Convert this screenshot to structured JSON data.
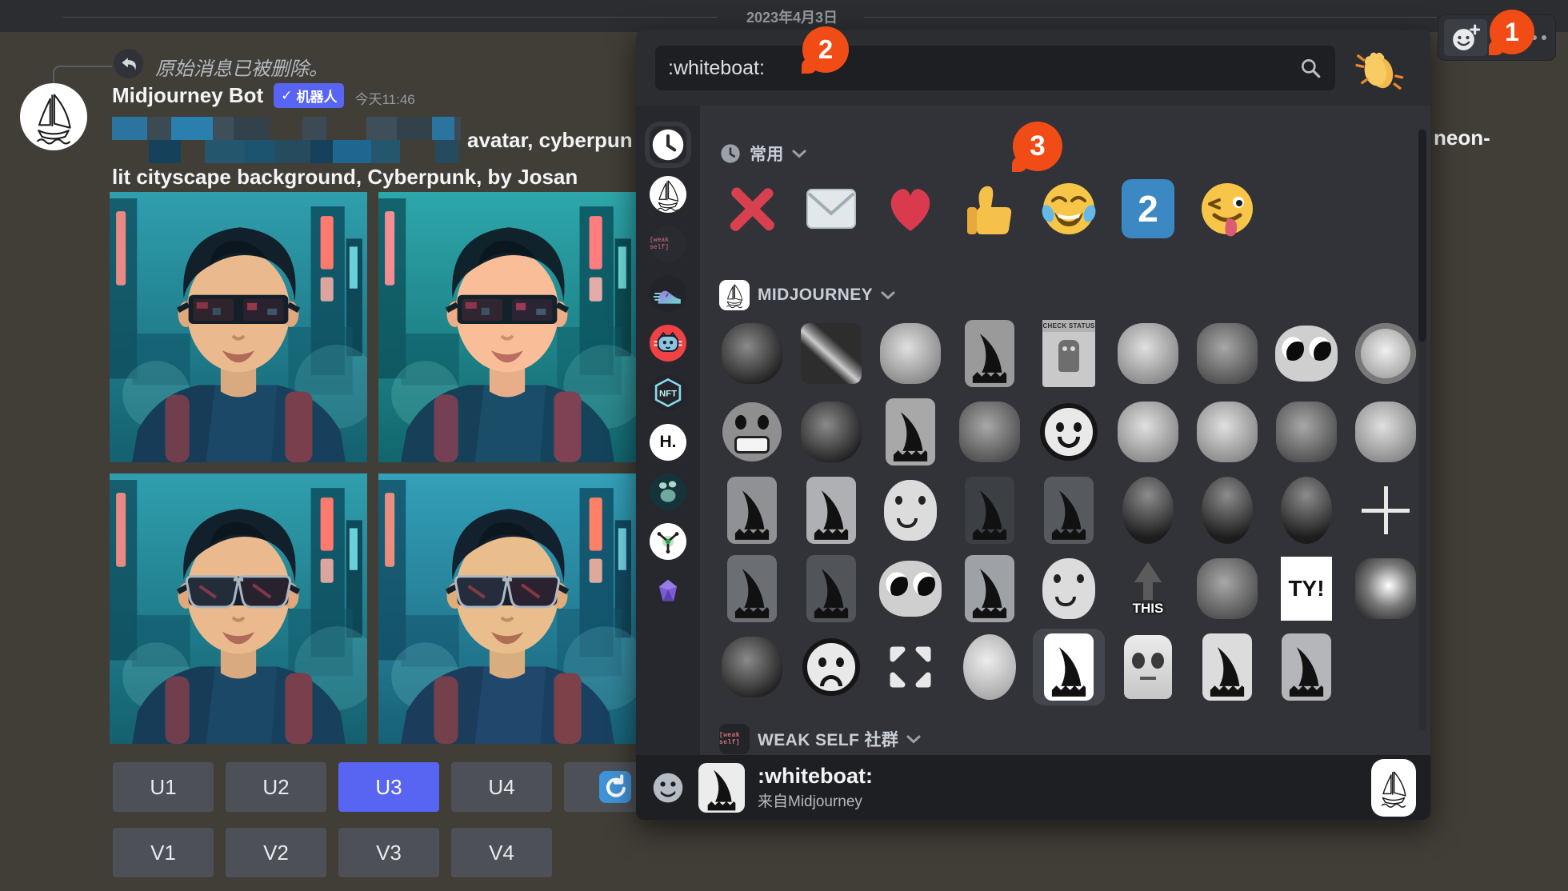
{
  "date_divider": "2023年4月3日",
  "reply": {
    "deleted_text": "原始消息已被删除。"
  },
  "message": {
    "author": "Midjourney Bot",
    "bot_check": "✓",
    "bot_badge": "机器人",
    "timestamp": "今天11:46",
    "line1_left": "avatar, cyberpun",
    "line1_right": "neon-",
    "line2": "lit cityscape background, Cyberpunk, by Josan"
  },
  "censor": {
    "palette": [
      "#2c74a0",
      "#1c546f",
      "#3c4a53",
      "#274b5e",
      "#2a7fae",
      "#15415a",
      "#3f4f59",
      "#1f6690",
      "#33414a",
      "#24566e"
    ],
    "widths": [
      44,
      30,
      52,
      26,
      46,
      40,
      30,
      50,
      38,
      44,
      28,
      48,
      36
    ]
  },
  "buttons": {
    "upscale": [
      "U1",
      "U2",
      "U3",
      "U4"
    ],
    "variation": [
      "V1",
      "V2",
      "V3",
      "V4"
    ],
    "active": "U3"
  },
  "annotations": {
    "one": "1",
    "two": "2",
    "three": "3"
  },
  "colors": {
    "accent": "#5865f2",
    "badge_red": "#f14b16",
    "button_gray": "#4d5057"
  },
  "picker": {
    "search_value": ":whiteboat:",
    "rail": [
      {
        "name": "recent-clock",
        "selected": true
      },
      {
        "name": "whiteboat-server"
      },
      {
        "name": "weak-self-server",
        "label": "[weak self]"
      },
      {
        "name": "sneaker-server"
      },
      {
        "name": "cat-server"
      },
      {
        "name": "nft-server",
        "label": "NFT"
      },
      {
        "name": "h-dot-server",
        "label": "H."
      },
      {
        "name": "paw-server"
      },
      {
        "name": "molecule-server"
      },
      {
        "name": "gem-server"
      }
    ],
    "frequent": {
      "label": "常用",
      "keycap_two": "2",
      "emojis": [
        "cross-mark",
        "envelope",
        "red-heart",
        "thumbs-up",
        "face-joy",
        "keycap-2",
        "winking-tongue"
      ]
    },
    "midjourney": {
      "label": "MIDJOURNEY",
      "rows": [
        [
          {
            "name": "spooky-cloud",
            "type": "photo",
            "tone": "p-dark"
          },
          {
            "name": "sword",
            "type": "photo",
            "tone": "p-streak"
          },
          {
            "name": "dog",
            "type": "photo",
            "tone": "p-light"
          },
          {
            "name": "whiteboat-gray",
            "type": "boat",
            "bg": "#9a9a9a"
          },
          {
            "name": "check-status",
            "type": "check",
            "label": "CHECK STATUS"
          },
          {
            "name": "doge",
            "type": "photo",
            "tone": "p-light"
          },
          {
            "name": "octopus-facepalm",
            "type": "photo",
            "tone": "p-mid"
          },
          {
            "name": "shiny-eyes",
            "type": "face",
            "variant": "f-bigeyes"
          },
          {
            "name": "no-ghost",
            "type": "photo",
            "tone": "p-ring"
          }
        ],
        [
          {
            "name": "scream-teeth",
            "type": "face",
            "variant": "f-teeth"
          },
          {
            "name": "galaxy-head",
            "type": "photo",
            "tone": "p-dark"
          },
          {
            "name": "whiteboat-2",
            "type": "boat",
            "bg": "#a8a8a8"
          },
          {
            "name": "bear-look",
            "type": "photo",
            "tone": "p-mid"
          },
          {
            "name": "doodle-smile",
            "type": "face",
            "variant": "f-smile"
          },
          {
            "name": "laugh-mask",
            "type": "photo",
            "tone": "p-light"
          },
          {
            "name": "cat-shock",
            "type": "photo",
            "tone": "p-light"
          },
          {
            "name": "muscle-man",
            "type": "photo",
            "tone": "p-mid"
          },
          {
            "name": "rain-blob",
            "type": "photo",
            "tone": "p-light"
          }
        ],
        [
          {
            "name": "whiteboat-3",
            "type": "boat",
            "bg": "#8f9194"
          },
          {
            "name": "whiteboat-4",
            "type": "boat",
            "bg": "#aeb0b3"
          },
          {
            "name": "blob-smile",
            "type": "face",
            "variant": "f-blob"
          },
          {
            "name": "whiteboat-dark",
            "type": "boat",
            "bg": "#3c3f44"
          },
          {
            "name": "whiteboat-5",
            "type": "boat",
            "bg": "#56595e"
          },
          {
            "name": "plague-doctor",
            "type": "photo",
            "tone": "p-ovaldark"
          },
          {
            "name": "skull-heart",
            "type": "photo",
            "tone": "p-ovaldark"
          },
          {
            "name": "plague-landscape",
            "type": "photo",
            "tone": "p-ovaldark"
          },
          {
            "name": "plus-sign",
            "type": "plus"
          }
        ],
        [
          {
            "name": "whiteboat-6",
            "type": "boat",
            "bg": "#6b6e73"
          },
          {
            "name": "whiteboat-7",
            "type": "boat",
            "bg": "#515459"
          },
          {
            "name": "wide-eyes",
            "type": "face",
            "variant": "f-bigeyes"
          },
          {
            "name": "whiteboat-8",
            "type": "boat",
            "bg": "#9ea1a5"
          },
          {
            "name": "ghost-thumb",
            "type": "face",
            "variant": "f-blob"
          },
          {
            "name": "this-arrow",
            "type": "this",
            "label": "THIS"
          },
          {
            "name": "rock-face",
            "type": "photo",
            "tone": "p-mid"
          },
          {
            "name": "ty-card",
            "type": "text",
            "label": "TY!"
          },
          {
            "name": "glow-smoke",
            "type": "photo",
            "tone": "p-glow"
          }
        ],
        [
          {
            "name": "smoke-ghost",
            "type": "photo",
            "tone": "p-dark"
          },
          {
            "name": "frown-doodle",
            "type": "face",
            "variant": "f-frown"
          },
          {
            "name": "expand-arrows",
            "type": "expand"
          },
          {
            "name": "moon-face",
            "type": "photo",
            "tone": "p-moon"
          },
          {
            "name": "whiteboat-selected",
            "type": "boat",
            "bg": "#ffffff",
            "selected": true
          },
          {
            "name": "robot-bust",
            "type": "robot"
          },
          {
            "name": "whiteboat-9",
            "type": "boat",
            "bg": "#dcdcdc"
          },
          {
            "name": "whiteboat-10",
            "type": "boat",
            "bg": "#b4b6b9"
          }
        ]
      ]
    },
    "weak_self": {
      "label": "WEAK SELF 社群",
      "icon_label": "[weak self]"
    },
    "preview": {
      "name": ":whiteboat:",
      "source": "来自Midjourney"
    }
  }
}
